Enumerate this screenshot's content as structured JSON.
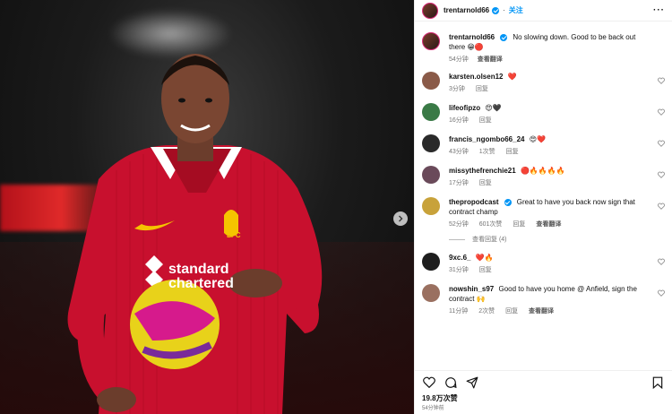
{
  "post": {
    "username": "trentarnold66",
    "follow_label": "关注",
    "more_label": "···",
    "caption": {
      "username": "trentarnold66",
      "text": "No slowing down. Good to be back out there 😁🔴",
      "time": "54分钟",
      "translate": "查看翻译"
    },
    "image_texts": {
      "sponsor": "standard chartered",
      "crest": "LFC"
    }
  },
  "comments": [
    {
      "username": "karsten.olsen12",
      "text": "❤️",
      "time": "3分钟",
      "reply": "回复",
      "avatar_color": "#8a5a48"
    },
    {
      "username": "lifeofipzo",
      "text": "😍🖤",
      "time": "16分钟",
      "reply": "回复",
      "avatar_color": "#3a7a46"
    },
    {
      "username": "francis_ngombo66_24",
      "text": "😍❤️",
      "time": "43分钟",
      "likes": "1次赞",
      "reply": "回复",
      "avatar_color": "#2a2a2a"
    },
    {
      "username": "missythefrenchie21",
      "text": "🔴🔥🔥🔥🔥",
      "time": "17分钟",
      "reply": "回复",
      "avatar_color": "#6a4a5a"
    },
    {
      "username": "thepropodcast",
      "text": "Great to have you back now sign that contract champ",
      "time": "52分钟",
      "likes": "601次赞",
      "reply": "回复",
      "translate": "查看翻译",
      "avatar_color": "#c8a23a",
      "verified": true
    },
    {
      "username": "9xc.6_",
      "text": "❤️🔥",
      "time": "31分钟",
      "reply": "回复",
      "avatar_color": "#1e1e1e"
    },
    {
      "username": "nowshin_s97",
      "text": "Good to have you home @ Anfield, sign the contract 🙌",
      "time": "11分钟",
      "likes": "2次赞",
      "reply": "回复",
      "translate": "查看翻译",
      "avatar_color": "#9a7060"
    }
  ],
  "replies_label": "查看回复 (4)",
  "footer": {
    "likes": "19.8万次赞",
    "time": "54分钟前"
  },
  "colors": {
    "accent": "#0095f6",
    "jersey": "#c8102e"
  }
}
